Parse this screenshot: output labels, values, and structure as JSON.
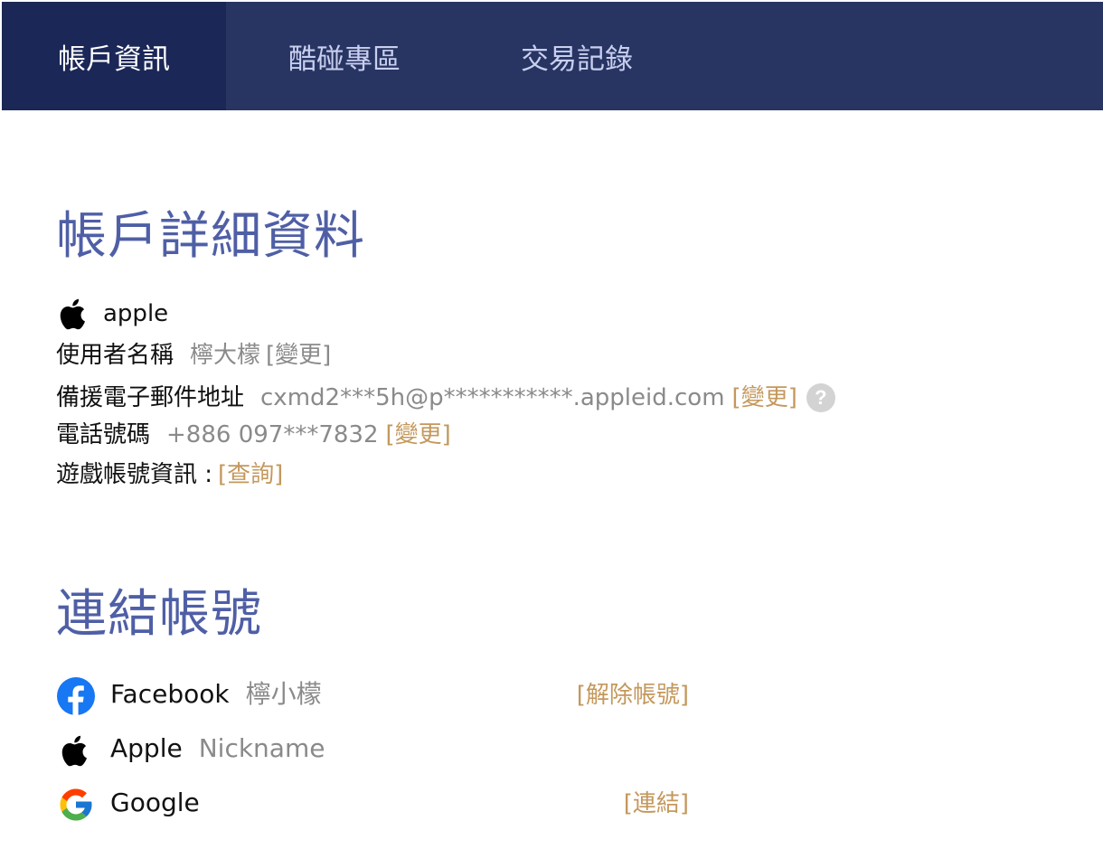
{
  "nav": {
    "tabs": [
      {
        "label": "帳戶資訊",
        "active": true
      },
      {
        "label": "酷碰專區",
        "active": false
      },
      {
        "label": "交易記錄",
        "active": false
      }
    ]
  },
  "account_details": {
    "title": "帳戶詳細資料",
    "login_provider": {
      "icon": "apple-icon",
      "label": "apple"
    },
    "username": {
      "label": "使用者名稱",
      "value": "檸大檬",
      "change": "[變更]"
    },
    "backup_email": {
      "label": "備援電子郵件地址",
      "value": "cxmd2***5h@p***********.appleid.com",
      "change": "[變更]",
      "help_icon": "?"
    },
    "phone": {
      "label": "電話號碼",
      "value": "+886 097***7832",
      "change": "[變更]"
    },
    "game_account": {
      "label": "遊戲帳號資訊 :",
      "query": "[查詢]"
    }
  },
  "linked_accounts": {
    "title": "連結帳號",
    "items": [
      {
        "icon": "facebook-icon",
        "provider": "Facebook",
        "nickname": "檸小檬",
        "action": "[解除帳號]"
      },
      {
        "icon": "apple-icon",
        "provider": "Apple",
        "nickname": "Nickname",
        "action": ""
      },
      {
        "icon": "google-icon",
        "provider": "Google",
        "nickname": "",
        "action": "[連結]"
      }
    ]
  },
  "colors": {
    "nav_bg": "#283563",
    "nav_active_bg": "#1b2757",
    "title": "#4f5fa6",
    "link_gold": "#c4985c",
    "muted": "#8a8a8a"
  }
}
